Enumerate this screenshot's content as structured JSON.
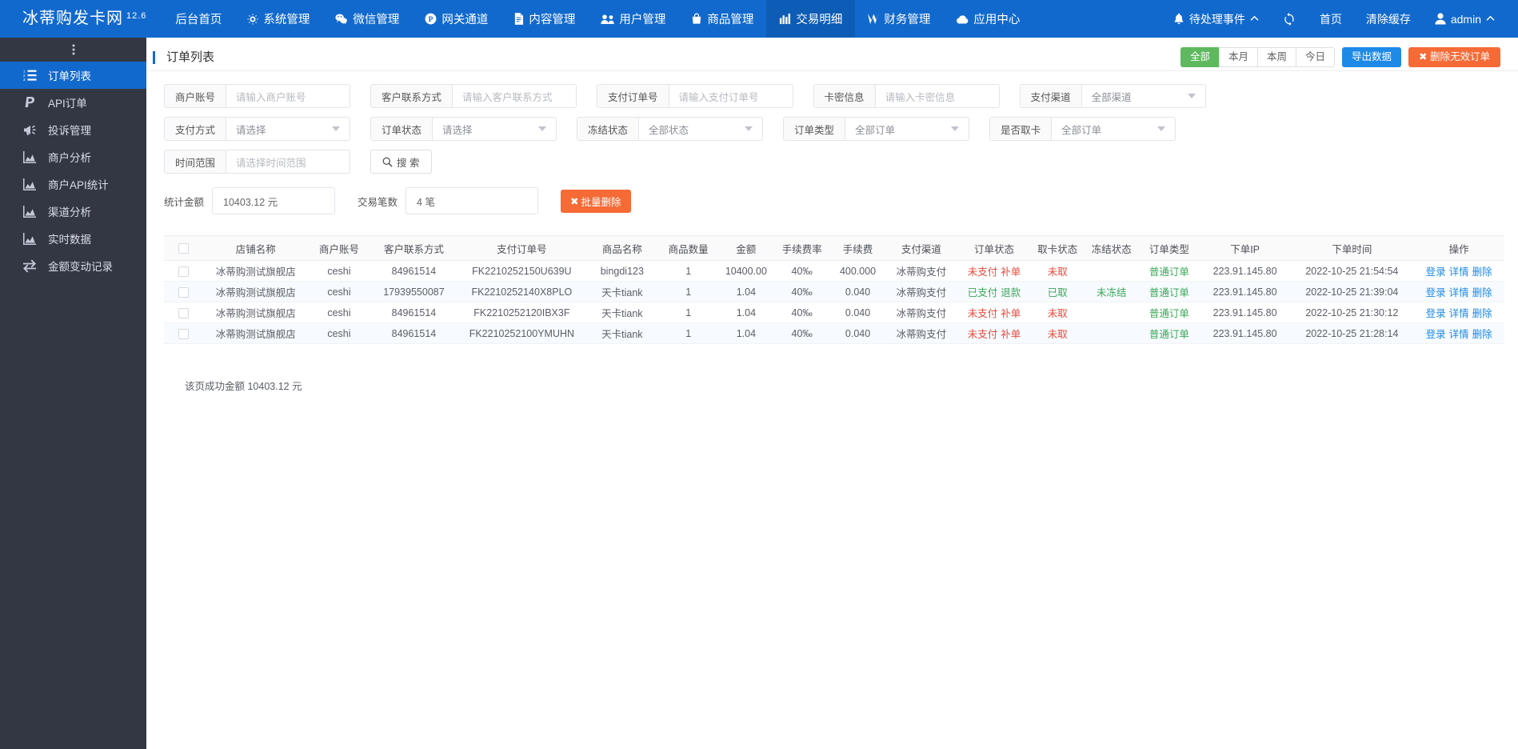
{
  "topnav": {
    "brand": "冰蒂购发卡网",
    "version": "12.6",
    "items": [
      {
        "label": "后台首页",
        "icon": null
      },
      {
        "label": "系统管理",
        "icon": "gear-icon"
      },
      {
        "label": "微信管理",
        "icon": "wechat-icon"
      },
      {
        "label": "网关通道",
        "icon": "paypal-circle-icon"
      },
      {
        "label": "内容管理",
        "icon": "document-icon"
      },
      {
        "label": "用户管理",
        "icon": "users-icon"
      },
      {
        "label": "商品管理",
        "icon": "bag-icon"
      },
      {
        "label": "交易明细",
        "icon": "barchart-icon",
        "active": true
      },
      {
        "label": "财务管理",
        "icon": "money-icon"
      },
      {
        "label": "应用中心",
        "icon": "cloud-icon"
      }
    ],
    "right": [
      {
        "label": "待处理事件",
        "icon": "bell-icon",
        "caret": "chevron-up"
      },
      {
        "label": "",
        "icon": "refresh-icon"
      },
      {
        "label": "首页",
        "icon": null
      },
      {
        "label": "清除缓存",
        "icon": null
      },
      {
        "label": "admin",
        "icon": "user-icon",
        "caret": "chevron-up"
      }
    ]
  },
  "sidebar": {
    "items": [
      {
        "label": "订单列表",
        "icon": "ordered-list-icon",
        "active": true
      },
      {
        "label": "API订单",
        "icon": "paypal-icon"
      },
      {
        "label": "投诉管理",
        "icon": "megaphone-icon"
      },
      {
        "label": "商户分析",
        "icon": "area-chart-icon"
      },
      {
        "label": "商户API统计",
        "icon": "area-chart-icon"
      },
      {
        "label": "渠道分析",
        "icon": "area-chart-icon"
      },
      {
        "label": "实时数据",
        "icon": "area-chart-icon"
      },
      {
        "label": "金额变动记录",
        "icon": "exchange-icon"
      }
    ]
  },
  "page": {
    "title": "订单列表",
    "head_buttons": {
      "all": "全部",
      "month": "本月",
      "week": "本周",
      "today": "今日",
      "export": "导出数据",
      "delete_invalid": "删除无效订单"
    }
  },
  "filters": {
    "row1": [
      {
        "label": "商户账号",
        "placeholder": "请输入商户账号",
        "type": "input"
      },
      {
        "label": "客户联系方式",
        "placeholder": "请输入客户联系方式",
        "type": "input"
      },
      {
        "label": "支付订单号",
        "placeholder": "请输入支付订单号",
        "type": "input"
      },
      {
        "label": "卡密信息",
        "placeholder": "请输入卡密信息",
        "type": "input"
      },
      {
        "label": "支付渠道",
        "value": "全部渠道",
        "type": "select"
      }
    ],
    "row2": [
      {
        "label": "支付方式",
        "value": "请选择",
        "type": "select"
      },
      {
        "label": "订单状态",
        "value": "请选择",
        "type": "select"
      },
      {
        "label": "冻结状态",
        "value": "全部状态",
        "type": "select"
      },
      {
        "label": "订单类型",
        "value": "全部订单",
        "type": "select"
      },
      {
        "label": "是否取卡",
        "value": "全部订单",
        "type": "select"
      }
    ],
    "row3": [
      {
        "label": "时间范围",
        "placeholder": "请选择时间范围",
        "type": "input"
      }
    ],
    "search_button": "搜 索"
  },
  "stats": {
    "amount_label": "统计金额",
    "amount_value": "10403.12 元",
    "count_label": "交易笔数",
    "count_value": "4 笔",
    "batch_delete": "批量删除"
  },
  "table": {
    "columns": [
      "",
      "店铺名称",
      "商户账号",
      "客户联系方式",
      "支付订单号",
      "商品名称",
      "商品数量",
      "金额",
      "手续费率",
      "手续费",
      "支付渠道",
      "订单状态",
      "取卡状态",
      "冻结状态",
      "订单类型",
      "下单IP",
      "下单时间",
      "操作"
    ],
    "rows": [
      {
        "shop": "冰蒂购测试旗舰店",
        "merchant": "ceshi",
        "contact": "84961514",
        "order_no": "FK2210252150U639U",
        "product": "bingdi123",
        "qty": "1",
        "amount": "10400.00",
        "fee_rate": "40‰",
        "fee": "400.000",
        "channel": "冰蒂购支付",
        "order_status": "未支付",
        "order_status_action": "补单",
        "order_status_color": "red",
        "card_status": "未取",
        "card_status_color": "red",
        "freeze_status": "",
        "freeze_status_color": "green",
        "order_type": "普通订单",
        "ip": "223.91.145.80",
        "time": "2022-10-25 21:54:54",
        "ops": [
          "登录",
          "详情",
          "删除"
        ]
      },
      {
        "shop": "冰蒂购测试旗舰店",
        "merchant": "ceshi",
        "contact": "17939550087",
        "order_no": "FK2210252140X8PLO",
        "product": "天卡tiank",
        "qty": "1",
        "amount": "1.04",
        "fee_rate": "40‰",
        "fee": "0.040",
        "channel": "冰蒂购支付",
        "order_status": "已支付",
        "order_status_action": "退款",
        "order_status_color": "green",
        "card_status": "已取",
        "card_status_color": "green",
        "freeze_status": "未冻结",
        "freeze_status_color": "green",
        "order_type": "普通订单",
        "ip": "223.91.145.80",
        "time": "2022-10-25 21:39:04",
        "ops": [
          "登录",
          "详情",
          "删除"
        ]
      },
      {
        "shop": "冰蒂购测试旗舰店",
        "merchant": "ceshi",
        "contact": "84961514",
        "order_no": "FK2210252120IBX3F",
        "product": "天卡tiank",
        "qty": "1",
        "amount": "1.04",
        "fee_rate": "40‰",
        "fee": "0.040",
        "channel": "冰蒂购支付",
        "order_status": "未支付",
        "order_status_action": "补单",
        "order_status_color": "red",
        "card_status": "未取",
        "card_status_color": "red",
        "freeze_status": "",
        "freeze_status_color": "green",
        "order_type": "普通订单",
        "ip": "223.91.145.80",
        "time": "2022-10-25 21:30:12",
        "ops": [
          "登录",
          "详情",
          "删除"
        ]
      },
      {
        "shop": "冰蒂购测试旗舰店",
        "merchant": "ceshi",
        "contact": "84961514",
        "order_no": "FK2210252100YMUHN",
        "product": "天卡tiank",
        "qty": "1",
        "amount": "1.04",
        "fee_rate": "40‰",
        "fee": "0.040",
        "channel": "冰蒂购支付",
        "order_status": "未支付",
        "order_status_action": "补单",
        "order_status_color": "red",
        "card_status": "未取",
        "card_status_color": "red",
        "freeze_status": "",
        "freeze_status_color": "green",
        "order_type": "普通订单",
        "ip": "223.91.145.80",
        "time": "2022-10-25 21:28:14",
        "ops": [
          "登录",
          "详情",
          "删除"
        ]
      }
    ]
  },
  "footer": {
    "summary": "该页成功金额 10403.12 元"
  },
  "colors": {
    "brand_blue": "#1269cd",
    "sidebar_dark": "#333744",
    "accent_green": "#5eb95e",
    "accent_orange": "#f56a35",
    "link_blue": "#1e8ae8",
    "danger_red": "#e8493b"
  }
}
